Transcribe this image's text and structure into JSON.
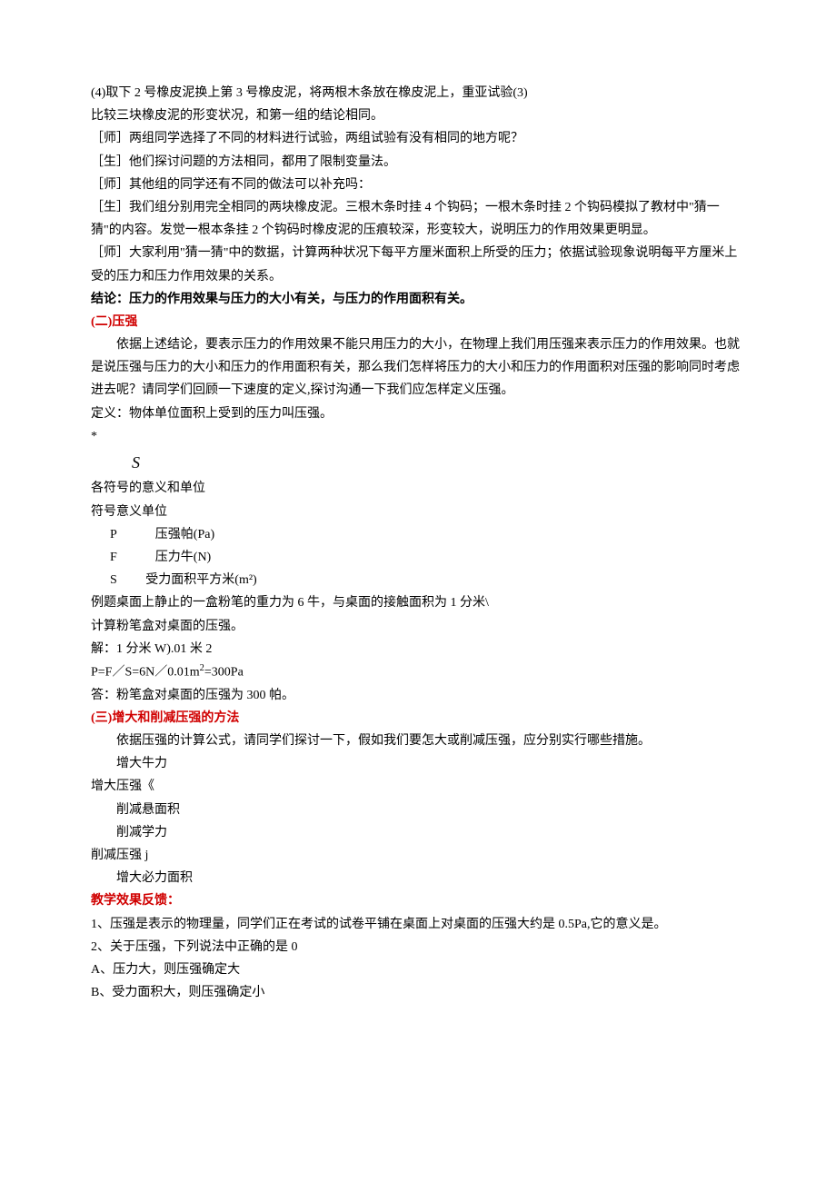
{
  "lines": {
    "l1": "(4)取下 2 号橡皮泥换上第 3 号橡皮泥，将两根木条放在橡皮泥上，重亚试验(3)",
    "l2": "比较三块橡皮泥的形变状况，和第一组的结论相同。",
    "l3": "［师］两组同学选择了不同的材料进行试验，两组试验有没有相同的地方呢？",
    "l4": "［生］他们探讨问题的方法相同，都用了限制变量法。",
    "l5": "［师］其他组的同学还有不同的做法可以补充吗：",
    "l6": "［生］我们组分别用完全相同的两块橡皮泥。三根木条时挂 4 个钩码；一根木条时挂 2 个钩码模拟了教材中\"猜一猜\"的内容。发觉一根本条挂 2 个钩码时橡皮泥的压痕较深，形变较大，说明压力的作用效果更明显。",
    "l7": "［师］大家利用\"猜一猜\"中的数据，计算两种状况下每平方厘米面积上所受的压力；依据试验现象说明每平方厘米上受的压力和压力作用效果的关系。",
    "conclusion": "结论：压力的作用效果与压力的大小有关，与压力的作用面积有关。",
    "h2": "(二)压强",
    "p2a": "依据上述结论，要表示压力的作用效果不能只用压力的大小，在物理上我们用压强来表示压力的作用效果。也就是说压强与压力的大小和压力的作用面积有关，那么我们怎样将压力的大小和压力的作用面积对压强的影响同时考虑进去呢？请同学们回顾一下速度的定义,探讨沟通一下我们应怎样定义压强。",
    "def": "定义：物体单位面积上受到的压力叫压强。",
    "star": "*",
    "s": "S",
    "sym1": "各符号的意义和单位",
    "sym2": "符号意义单位",
    "rowP": "P   压强帕(Pa)",
    "rowF": "F   压力牛(N)",
    "rowS": "S   受力面积平方米(m²)",
    "ex1": "例题桌面上静止的一盒粉笔的重力为 6 牛，与桌面的接触面积为 1 分米\\",
    "ex2": "计算粉笔盒对桌面的压强。",
    "ex3": "解：1 分米 W).01 米 2",
    "ex4a": "P=F／S=6N／0.01m",
    "ex4b": "2",
    "ex4c": "=300Pa",
    "ex5": "答：粉笔盒对桌面的压强为 300 帕。",
    "h3": "(三)增大和削减压强的方法",
    "p3a": "依据压强的计算公式，请同学们探讨一下，假如我们要怎大或削减压强，应分别实行哪些措施。",
    "p3b": "增大牛力",
    "p3c": "增大压强《",
    "p3d": "削减悬面积",
    "p3e": "削减学力",
    "p3f": "削减压强 j",
    "p3g": "增大必力面积",
    "fb": "教学效果反馈：",
    "q1": "1、压强是表示的物理量，同学们正在考试的试卷平铺在桌面上对桌面的压强大约是 0.5Pa,它的意义是。",
    "q2": "2、关于压强，下列说法中正确的是 0",
    "qa": "A、压力大，则压强确定大",
    "qb": "B、受力面积大，则压强确定小"
  }
}
